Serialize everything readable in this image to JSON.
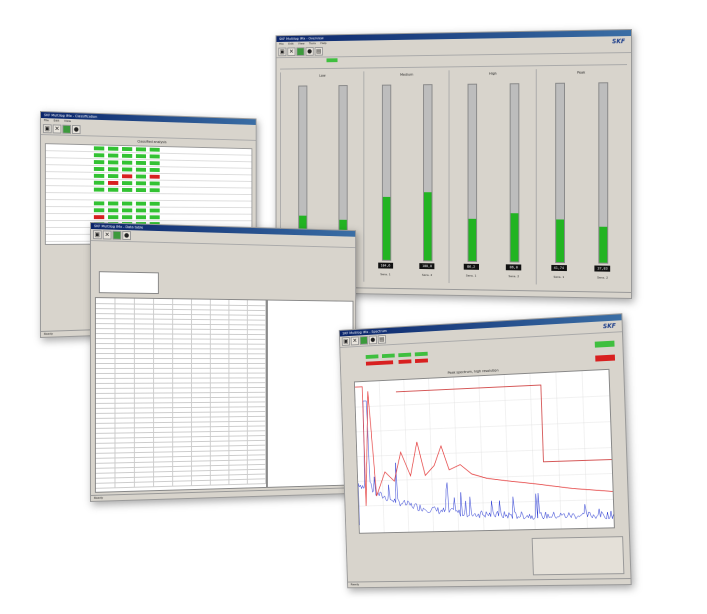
{
  "skf_logo": "SKF",
  "win_a": {
    "title": "SKF Multilog IMx - Overview",
    "menu": [
      "File",
      "Edit",
      "View",
      "Tools",
      "Help"
    ],
    "header": "Overall levels",
    "gauges": [
      {
        "label": "Low",
        "level": 0.25,
        "value": "67,8",
        "sensor": "Sens. 1",
        "threshold": "Threshold",
        "bar": "red"
      },
      {
        "label": "",
        "level": 0.23,
        "value": "66,5",
        "sensor": "Sens. 2",
        "bar": "red"
      },
      {
        "label": "Medium",
        "level": 0.36,
        "value": "104,6",
        "sensor": "Sens. 1",
        "bar": "red"
      },
      {
        "label": "",
        "level": 0.39,
        "value": "100,0",
        "sensor": "Sens. 2",
        "bar": "red"
      },
      {
        "label": "High",
        "level": 0.24,
        "value": "86,2",
        "sensor": "Sens. 1",
        "bar": "red"
      },
      {
        "label": "",
        "level": 0.27,
        "value": "86,0",
        "sensor": "Sens. 2",
        "bar": "red"
      },
      {
        "label": "Peak",
        "level": 0.24,
        "value": "41,74",
        "sensor": "Sens. 1",
        "bar": "red"
      },
      {
        "label": "",
        "level": 0.2,
        "value": "37,03",
        "sensor": "Sens. 2",
        "bar": "red"
      }
    ],
    "status": "Ready"
  },
  "win_b": {
    "title": "SKF Multilog IMx - Classification",
    "header": "Classified analysis",
    "rows": 14,
    "status": "Ready"
  },
  "win_c": {
    "title": "SKF Multilog IMx - Data table",
    "rows": 38,
    "cols": 9,
    "status": "Ready"
  },
  "win_d": {
    "title": "SKF Multilog IMx - Spectrum",
    "chart_title": "Peak spectrum, high resolution",
    "status": "Ready"
  }
}
